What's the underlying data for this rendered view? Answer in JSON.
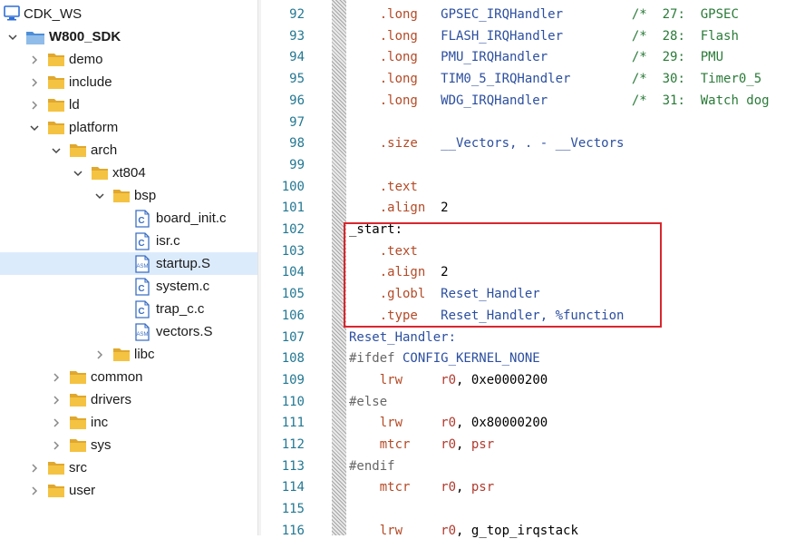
{
  "tree": {
    "items": [
      {
        "label": "CDK_WS",
        "indent": 0,
        "icon": "monitor",
        "expand": "none",
        "bold": false,
        "selected": false
      },
      {
        "label": "W800_SDK",
        "indent": 1,
        "icon": "project-folder",
        "expand": "open",
        "bold": true,
        "selected": false
      },
      {
        "label": "demo",
        "indent": 2,
        "icon": "folder",
        "expand": "closed",
        "bold": false,
        "selected": false
      },
      {
        "label": "include",
        "indent": 2,
        "icon": "folder",
        "expand": "closed",
        "bold": false,
        "selected": false
      },
      {
        "label": "ld",
        "indent": 2,
        "icon": "folder",
        "expand": "closed",
        "bold": false,
        "selected": false
      },
      {
        "label": "platform",
        "indent": 2,
        "icon": "folder",
        "expand": "open",
        "bold": false,
        "selected": false
      },
      {
        "label": "arch",
        "indent": 3,
        "icon": "folder",
        "expand": "open",
        "bold": false,
        "selected": false
      },
      {
        "label": "xt804",
        "indent": 4,
        "icon": "folder",
        "expand": "open",
        "bold": false,
        "selected": false
      },
      {
        "label": "bsp",
        "indent": 5,
        "icon": "folder",
        "expand": "open",
        "bold": false,
        "selected": false
      },
      {
        "label": "board_init.c",
        "indent": 6,
        "icon": "c-file",
        "expand": "none",
        "bold": false,
        "selected": false
      },
      {
        "label": "isr.c",
        "indent": 6,
        "icon": "c-file",
        "expand": "none",
        "bold": false,
        "selected": false
      },
      {
        "label": "startup.S",
        "indent": 6,
        "icon": "asm-file",
        "expand": "none",
        "bold": false,
        "selected": true
      },
      {
        "label": "system.c",
        "indent": 6,
        "icon": "c-file",
        "expand": "none",
        "bold": false,
        "selected": false
      },
      {
        "label": "trap_c.c",
        "indent": 6,
        "icon": "c-file",
        "expand": "none",
        "bold": false,
        "selected": false
      },
      {
        "label": "vectors.S",
        "indent": 6,
        "icon": "asm-file",
        "expand": "none",
        "bold": false,
        "selected": false
      },
      {
        "label": "libc",
        "indent": 5,
        "icon": "folder",
        "expand": "closed",
        "bold": false,
        "selected": false
      },
      {
        "label": "common",
        "indent": 3,
        "icon": "folder",
        "expand": "closed",
        "bold": false,
        "selected": false
      },
      {
        "label": "drivers",
        "indent": 3,
        "icon": "folder",
        "expand": "closed",
        "bold": false,
        "selected": false
      },
      {
        "label": "inc",
        "indent": 3,
        "icon": "folder",
        "expand": "closed",
        "bold": false,
        "selected": false
      },
      {
        "label": "sys",
        "indent": 3,
        "icon": "folder",
        "expand": "closed",
        "bold": false,
        "selected": false
      },
      {
        "label": "src",
        "indent": 2,
        "icon": "folder",
        "expand": "closed",
        "bold": false,
        "selected": false
      },
      {
        "label": "user",
        "indent": 2,
        "icon": "folder",
        "expand": "closed",
        "bold": false,
        "selected": false
      }
    ],
    "c_icon_letter": "C",
    "asm_icon_letter": "ASM"
  },
  "editor": {
    "lines": [
      {
        "n": "92",
        "tokens": [
          [
            "d",
            "    .long"
          ],
          [
            "i",
            "   GPSEC_IRQHandler"
          ],
          [
            "p",
            "         "
          ],
          [
            "c",
            "/*  27:  GPSEC"
          ]
        ]
      },
      {
        "n": "93",
        "tokens": [
          [
            "d",
            "    .long"
          ],
          [
            "i",
            "   FLASH_IRQHandler"
          ],
          [
            "p",
            "         "
          ],
          [
            "c",
            "/*  28:  Flash"
          ]
        ]
      },
      {
        "n": "94",
        "tokens": [
          [
            "d",
            "    .long"
          ],
          [
            "i",
            "   PMU_IRQHandler"
          ],
          [
            "p",
            "           "
          ],
          [
            "c",
            "/*  29:  PMU"
          ]
        ]
      },
      {
        "n": "95",
        "tokens": [
          [
            "d",
            "    .long"
          ],
          [
            "i",
            "   TIM0_5_IRQHandler"
          ],
          [
            "p",
            "        "
          ],
          [
            "c",
            "/*  30:  Timer0_5"
          ]
        ]
      },
      {
        "n": "96",
        "tokens": [
          [
            "d",
            "    .long"
          ],
          [
            "i",
            "   WDG_IRQHandler"
          ],
          [
            "p",
            "           "
          ],
          [
            "c",
            "/*  31:  Watch dog"
          ]
        ]
      },
      {
        "n": "97",
        "tokens": []
      },
      {
        "n": "98",
        "tokens": [
          [
            "d",
            "    .size"
          ],
          [
            "i",
            "   __Vectors, . - __Vectors"
          ]
        ]
      },
      {
        "n": "99",
        "tokens": []
      },
      {
        "n": "100",
        "tokens": [
          [
            "d",
            "    .text"
          ]
        ]
      },
      {
        "n": "101",
        "tokens": [
          [
            "d",
            "    .align"
          ],
          [
            "l",
            "  2"
          ]
        ]
      },
      {
        "n": "102",
        "tokens": [
          [
            "l",
            "_start:"
          ]
        ]
      },
      {
        "n": "103",
        "tokens": [
          [
            "d",
            "    .text"
          ]
        ]
      },
      {
        "n": "104",
        "tokens": [
          [
            "d",
            "    .align"
          ],
          [
            "l",
            "  2"
          ]
        ]
      },
      {
        "n": "105",
        "tokens": [
          [
            "d",
            "    .globl"
          ],
          [
            "i",
            "  Reset_Handler"
          ]
        ]
      },
      {
        "n": "106",
        "tokens": [
          [
            "d",
            "    .type"
          ],
          [
            "i",
            "   Reset_Handler, %function"
          ]
        ]
      },
      {
        "n": "107",
        "tokens": [
          [
            "i",
            "Reset_Handler:"
          ]
        ]
      },
      {
        "n": "108",
        "tokens": [
          [
            "p",
            "#ifdef"
          ],
          [
            "i",
            " CONFIG_KERNEL_NONE"
          ]
        ]
      },
      {
        "n": "109",
        "tokens": [
          [
            "d",
            "    lrw"
          ],
          [
            "r",
            "     r0"
          ],
          [
            "l",
            ", 0xe0000200"
          ]
        ]
      },
      {
        "n": "110",
        "tokens": [
          [
            "p",
            "#else"
          ]
        ]
      },
      {
        "n": "111",
        "tokens": [
          [
            "d",
            "    lrw"
          ],
          [
            "r",
            "     r0"
          ],
          [
            "l",
            ", 0x80000200"
          ]
        ]
      },
      {
        "n": "112",
        "tokens": [
          [
            "d",
            "    mtcr"
          ],
          [
            "r",
            "    r0"
          ],
          [
            "l",
            ", "
          ],
          [
            "r",
            "psr"
          ]
        ]
      },
      {
        "n": "113",
        "tokens": [
          [
            "p",
            "#endif"
          ]
        ]
      },
      {
        "n": "114",
        "tokens": [
          [
            "d",
            "    mtcr"
          ],
          [
            "r",
            "    r0"
          ],
          [
            "l",
            ", "
          ],
          [
            "r",
            "psr"
          ]
        ]
      },
      {
        "n": "115",
        "tokens": []
      },
      {
        "n": "116",
        "tokens": [
          [
            "d",
            "    lrw"
          ],
          [
            "r",
            "     r0"
          ],
          [
            "l",
            ", g_top_irqstack"
          ]
        ]
      }
    ]
  },
  "colors": {
    "selection": "#dcebfc",
    "folder": "#f5c342",
    "highlight_box": "#d9262e"
  }
}
